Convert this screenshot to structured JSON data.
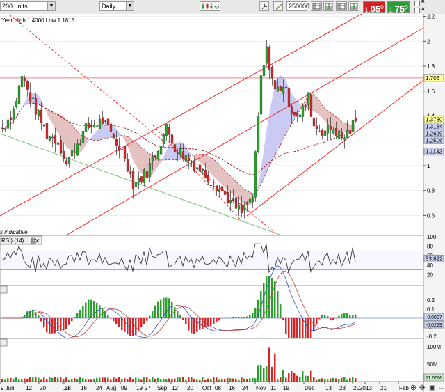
{
  "toolbar": {
    "units_value": "200 units",
    "interval_value": "Daily",
    "quantity_value": "250000",
    "sell_price_small": "1.",
    "sell_price_big": "05",
    "sell_price_sup": "0",
    "buy_price_small": "1.",
    "buy_price_big": "75",
    "buy_price_sup": "0",
    "checkbox_labels": [
      "B",
      "A",
      "V"
    ]
  },
  "legend": {
    "year_range": "Year High 1.4000 Low 1.1815",
    "indicative": "s indicative",
    "rsi_label": "RSI) (14)"
  },
  "chart_data": {
    "type": "candlestick",
    "price_axis": {
      "range": [
        0.44,
        2.22
      ],
      "ticks": [
        "2.2",
        "2",
        "1.8",
        "1.6",
        "1.4",
        "1.2",
        "1",
        "0.8",
        "0.6"
      ],
      "tick_values": [
        2.2,
        2.0,
        1.8,
        1.6,
        1.4,
        1.2,
        1.0,
        0.8,
        0.6
      ],
      "resistance_level": "1.706",
      "value_labels": [
        {
          "text": "1.3730",
          "value": 1.373,
          "bg": "#ffff99"
        },
        {
          "text": "1.3184",
          "value": 1.3184,
          "bg": "#c8d2f0"
        },
        {
          "text": "1.2629",
          "value": 1.2629,
          "bg": "#c8d2f0"
        },
        {
          "text": "1.2506",
          "value": 1.2506,
          "bg": "#c8d2f0"
        },
        {
          "text": "1.1132",
          "value": 1.1132,
          "bg": "#c8d2f0"
        }
      ]
    },
    "rsi": {
      "axis_ticks": [
        "100",
        "80",
        "60",
        "40",
        "20"
      ],
      "tick_values": [
        100,
        80,
        60,
        40,
        20
      ],
      "overbought": 70,
      "oversold": 30,
      "last_value": "53.822"
    },
    "macd": {
      "axis_ticks": [
        "0.2",
        "0.1",
        "-0.1",
        "-0.2"
      ],
      "tick_values": [
        0.2,
        0.1,
        -0.1,
        -0.2
      ],
      "last_value_1": "-0.0097",
      "last_value_2": "-0.0229"
    },
    "volume": {
      "axis_ticks": [
        "100M",
        "50M"
      ],
      "tick_values": [
        100,
        50
      ],
      "last_value": "11.66M"
    },
    "x_labels": [
      "9 Jun",
      "12",
      "20",
      "Jul",
      "08",
      "16",
      "24",
      "Aug",
      "09",
      "19",
      "27",
      "Sep",
      "12",
      "20",
      "Oct",
      "08",
      "16",
      "24",
      "Nov",
      "11",
      "19",
      "Dec",
      "13",
      "23",
      "2020",
      "13",
      "21",
      "Feb"
    ]
  },
  "colors": {
    "up_candle": "#2ca02c",
    "down_candle": "#d62728",
    "trend_line": "#ff2020",
    "support_line": "#7cc27c",
    "cloud_red": "#c47777",
    "cloud_blue": "#8a8ae8"
  }
}
